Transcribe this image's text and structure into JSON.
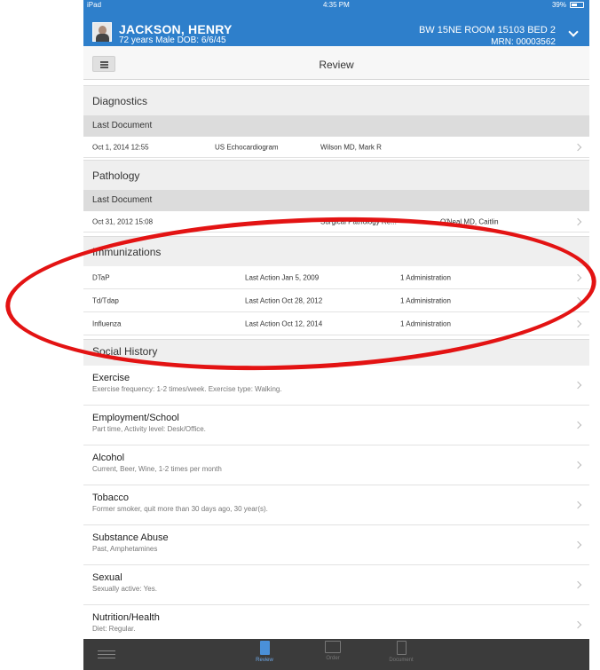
{
  "status_bar": {
    "carrier": "iPad",
    "time": "4:35 PM",
    "battery": "39%"
  },
  "patient": {
    "name": "JACKSON, HENRY",
    "info": "72 years  Male  DOB: 6/6/45",
    "location": "BW 15NE ROOM 15103 BED 2",
    "mrn": "MRN: 00003562"
  },
  "nav": {
    "title": "Review"
  },
  "diagnostics": {
    "header": "Diagnostics",
    "subheader": "Last Document",
    "rows": [
      {
        "date": "Oct 1, 2014 12:55",
        "type": "US Echocardiogram",
        "author": "Wilson MD, Mark R"
      }
    ]
  },
  "pathology": {
    "header": "Pathology",
    "subheader": "Last Document",
    "rows": [
      {
        "date": "Oct 31, 2012 15:08",
        "type": "Surgical Pathology Re...",
        "author": "O'Neal MD, Caitlin"
      }
    ]
  },
  "immunizations": {
    "header": "Immunizations",
    "rows": [
      {
        "name": "DTaP",
        "action": "Last Action Jan 5, 2009",
        "count": "1 Administration"
      },
      {
        "name": "Td/Tdap",
        "action": "Last Action Oct 28, 2012",
        "count": "1 Administration"
      },
      {
        "name": "Influenza",
        "action": "Last Action Oct 12, 2014",
        "count": "1 Administration"
      }
    ]
  },
  "social_history": {
    "header": "Social History",
    "items": [
      {
        "title": "Exercise",
        "desc": "Exercise frequency: 1-2 times/week. Exercise type: Walking."
      },
      {
        "title": "Employment/School",
        "desc": "Part time, Activity level: Desk/Office."
      },
      {
        "title": "Alcohol",
        "desc": "Current, Beer, Wine, 1-2 times per month"
      },
      {
        "title": "Tobacco",
        "desc": "Former smoker, quit more than 30 days ago, 30 year(s)."
      },
      {
        "title": "Substance Abuse",
        "desc": "Past, Amphetamines"
      },
      {
        "title": "Sexual",
        "desc": "Sexually active: Yes."
      },
      {
        "title": "Nutrition/Health",
        "desc": "Diet: Regular."
      }
    ]
  },
  "tabs": [
    {
      "label": "Review",
      "icon": "review-icon",
      "active": true
    },
    {
      "label": "Order",
      "icon": "order-icon",
      "active": false
    },
    {
      "label": "Document",
      "icon": "document-icon",
      "active": false
    }
  ],
  "annotation_color": "#e31313",
  "accent_color": "#2e7fcb"
}
